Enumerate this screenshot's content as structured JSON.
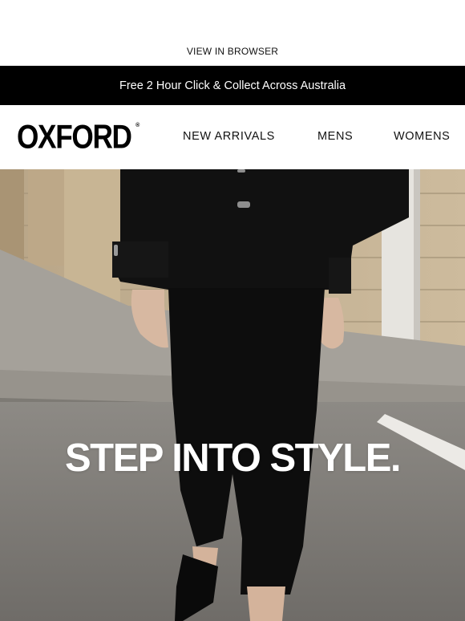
{
  "top_link": {
    "label": "VIEW IN BROWSER"
  },
  "promo_bar": {
    "text": "Free 2 Hour Click & Collect Across Australia",
    "background": "#000000",
    "text_color": "#ffffff"
  },
  "header": {
    "logo": {
      "text": "OXFORD",
      "mark": "®"
    },
    "nav": [
      {
        "label": "NEW ARRIVALS"
      },
      {
        "label": "MENS"
      },
      {
        "label": "WOMENS"
      }
    ]
  },
  "hero": {
    "image": "woman-in-black-jacket-and-cropped-flare-pants-walking-on-street",
    "headline": "STEP INTO STYLE."
  }
}
